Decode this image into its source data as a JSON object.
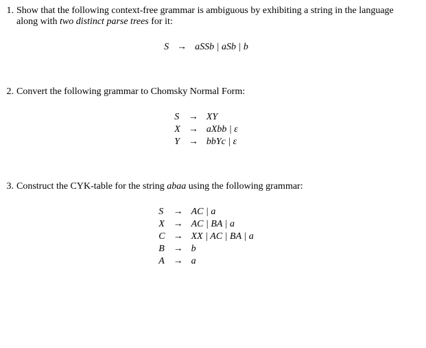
{
  "problems": [
    {
      "num": "1.",
      "text_parts": {
        "p1": "Show that the following context-free grammar is ambiguous by exhibiting a string in the language along with ",
        "p2_italic": "two distinct parse trees",
        "p3": " for it:"
      },
      "grammar": [
        {
          "lhs": "S",
          "arrow": "→",
          "rhs": "aSSb | aSb | b"
        }
      ]
    },
    {
      "num": "2.",
      "text_parts": {
        "p1": "Convert the following grammar to Chomsky Normal Form:"
      },
      "grammar": [
        {
          "lhs": "S",
          "arrow": "→",
          "rhs": "XY"
        },
        {
          "lhs": "X",
          "arrow": "→",
          "rhs": "aXbb | ε"
        },
        {
          "lhs": "Y",
          "arrow": "→",
          "rhs": "bbYc | ε"
        }
      ]
    },
    {
      "num": "3.",
      "text_parts": {
        "p1": "Construct the CYK-table for the string ",
        "p2_italic": "abaa",
        "p3": " using the following grammar:"
      },
      "grammar": [
        {
          "lhs": "S",
          "arrow": "→",
          "rhs": "AC | a"
        },
        {
          "lhs": "X",
          "arrow": "→",
          "rhs": "AC | BA | a"
        },
        {
          "lhs": "C",
          "arrow": "→",
          "rhs": "XX | AC | BA | a"
        },
        {
          "lhs": "B",
          "arrow": "→",
          "rhs": "b"
        },
        {
          "lhs": "A",
          "arrow": "→",
          "rhs": "a"
        }
      ]
    }
  ]
}
